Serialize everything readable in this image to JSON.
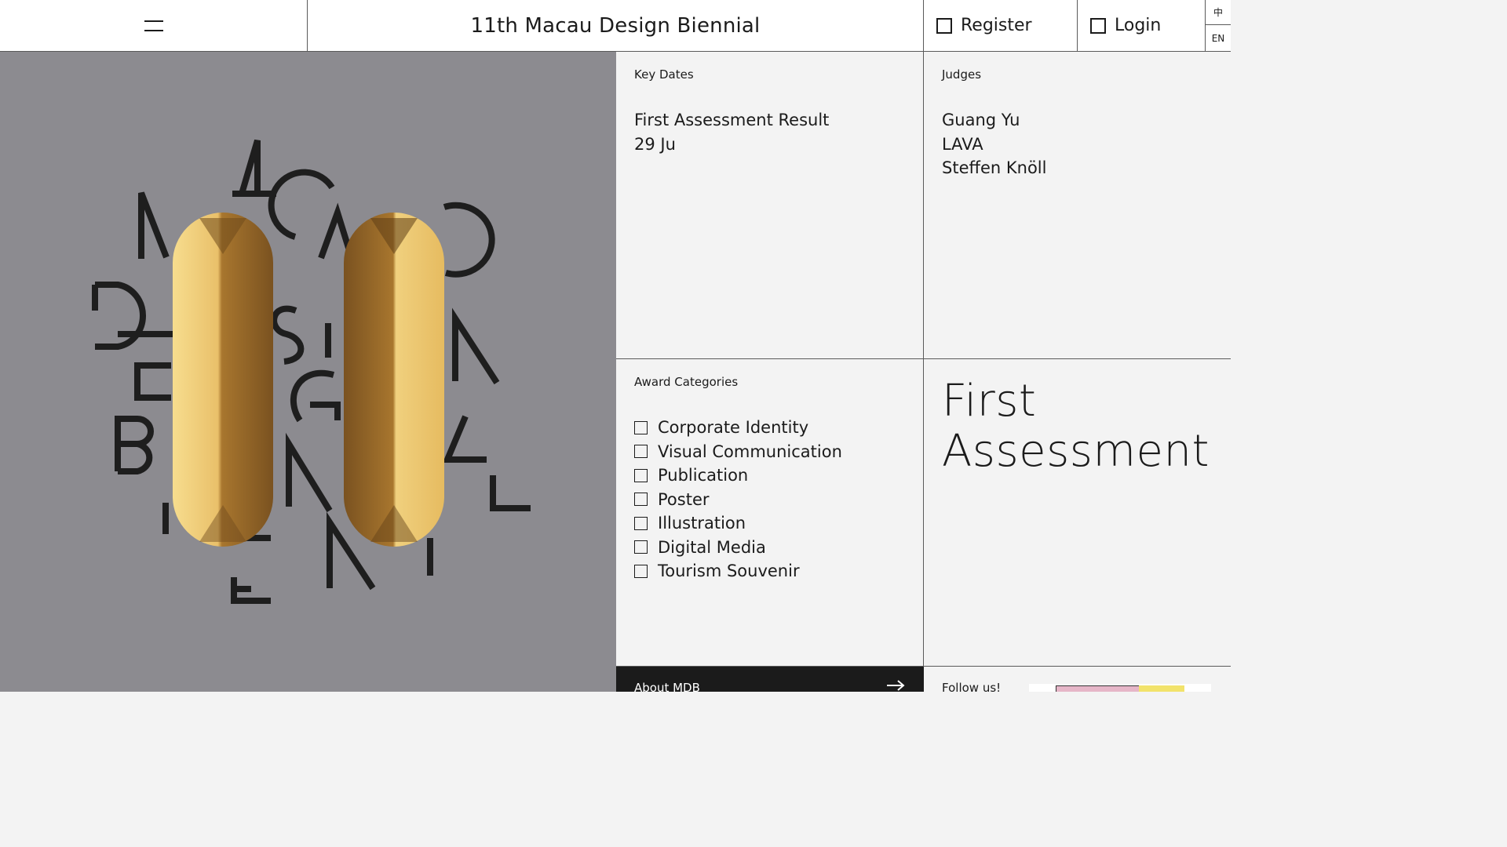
{
  "header": {
    "title": "11th Macau Design Biennial",
    "register_label": "Register",
    "login_label": "Login",
    "lang_zh": "中",
    "lang_en": "EN"
  },
  "hero": {
    "text_lines": [
      "MACAO",
      "DESIGN",
      "BIENNIAL"
    ],
    "gold_color": "#c89a3c",
    "background": "#8c8b90"
  },
  "key_dates": {
    "label": "Key Dates",
    "event": "First Assessment Result",
    "date": "29 Ju"
  },
  "judges": {
    "label": "Judges",
    "names": [
      "Guang Yu",
      "LAVA",
      "Steffen Knöll"
    ]
  },
  "award_categories": {
    "label": "Award Categories",
    "items": [
      "Corporate Identity",
      "Visual Communication",
      "Publication",
      "Poster",
      "Illustration",
      "Digital Media",
      "Tourism Souvenir"
    ]
  },
  "headline": {
    "line1": "First",
    "line2": "Assessment"
  },
  "footer": {
    "about_label": "About MDB",
    "follow_label": "Follow us!"
  }
}
